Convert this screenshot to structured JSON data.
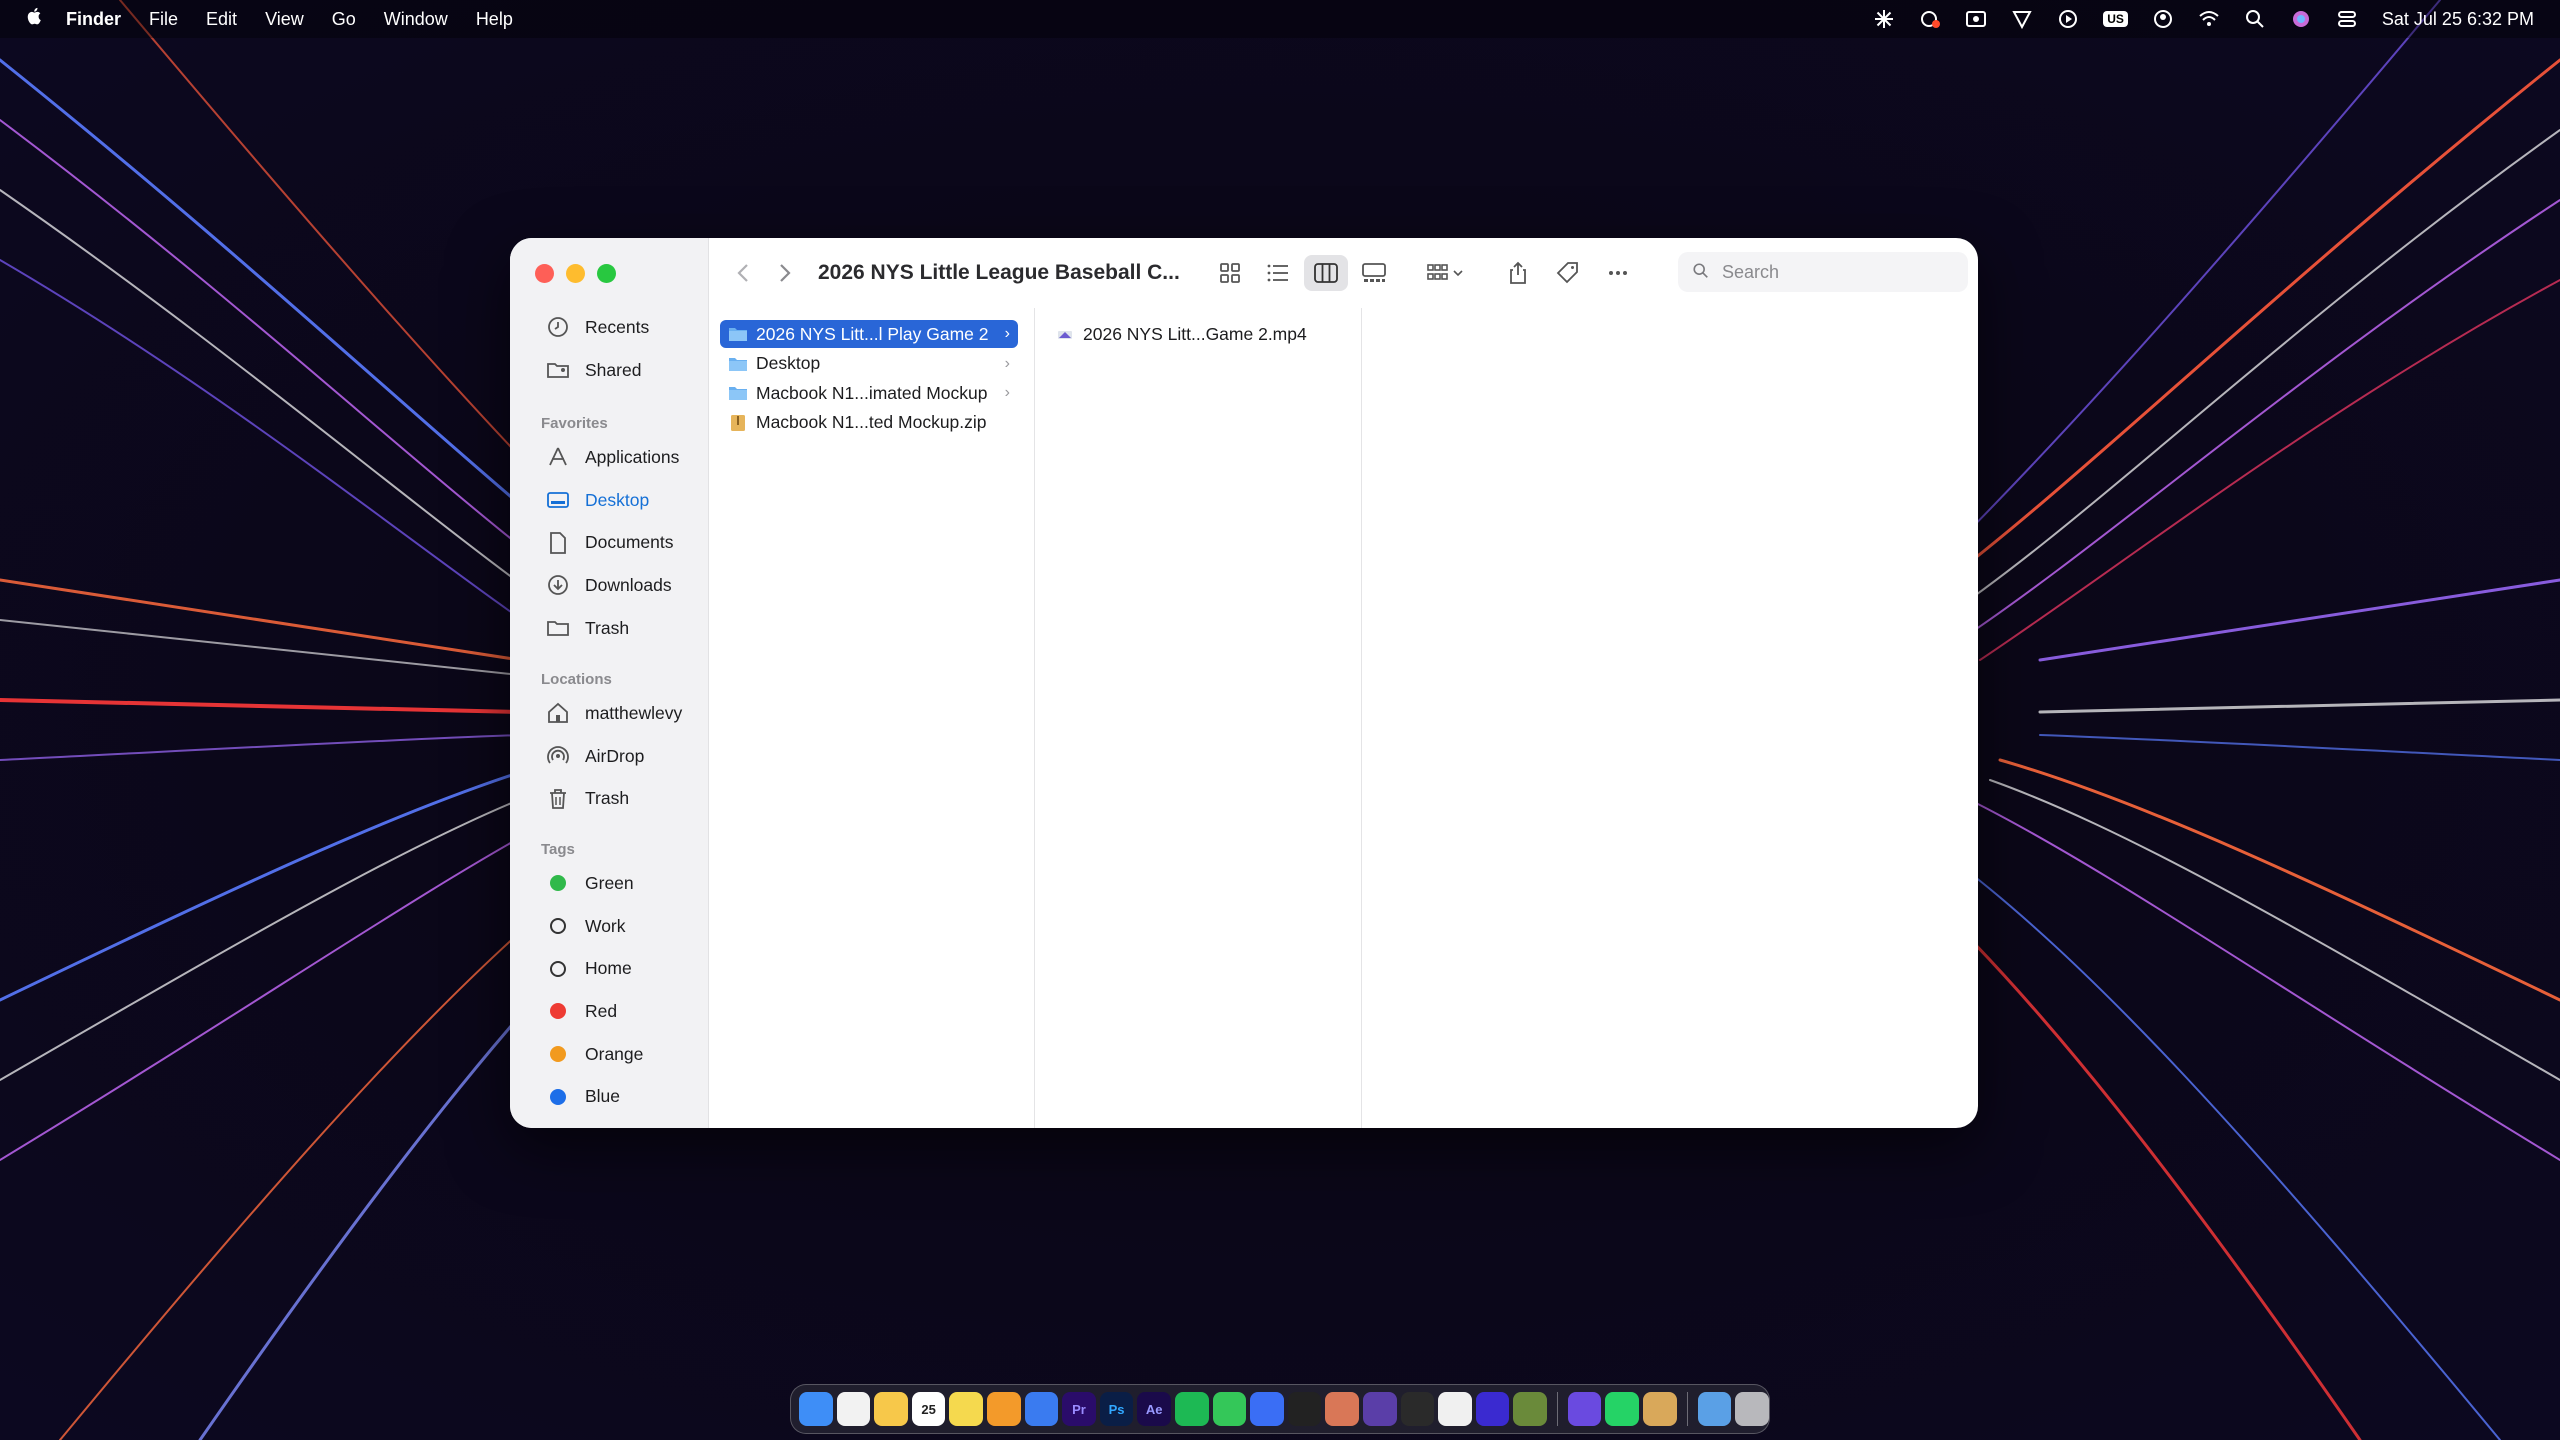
{
  "menubar": {
    "app_name": "Finder",
    "menus": [
      "File",
      "Edit",
      "View",
      "Go",
      "Window",
      "Help"
    ],
    "keyboard_badge": "US",
    "clock": "Sat Jul 25  6:32 PM"
  },
  "window": {
    "title": "2026 NYS Little League Baseball C...",
    "search_placeholder": "Search"
  },
  "sidebar": {
    "top_items": [
      {
        "label": "Recents",
        "icon": "clock-icon"
      },
      {
        "label": "Shared",
        "icon": "shared-folder-icon"
      }
    ],
    "favorites_heading": "Favorites",
    "favorites": [
      {
        "label": "Applications",
        "icon": "applications-icon"
      },
      {
        "label": "Desktop",
        "icon": "desktop-icon"
      },
      {
        "label": "Documents",
        "icon": "document-icon"
      },
      {
        "label": "Downloads",
        "icon": "download-icon"
      },
      {
        "label": "Trash",
        "icon": "folder-icon"
      }
    ],
    "locations_heading": "Locations",
    "locations": [
      {
        "label": "matthewlevy",
        "icon": "home-icon"
      },
      {
        "label": "AirDrop",
        "icon": "airdrop-icon"
      },
      {
        "label": "Trash",
        "icon": "trash-icon"
      }
    ],
    "tags_heading": "Tags",
    "tags": [
      {
        "label": "Green",
        "color": "#30b94a"
      },
      {
        "label": "Work",
        "color": "hollow"
      },
      {
        "label": "Home",
        "color": "hollow"
      },
      {
        "label": "Red",
        "color": "#ee3b33"
      },
      {
        "label": "Orange",
        "color": "#f29a1e"
      },
      {
        "label": "Blue",
        "color": "#1d6ee8"
      }
    ]
  },
  "columns": {
    "col1": [
      {
        "name": "2026 NYS Litt...l Play Game 2",
        "kind": "folder",
        "selected": true
      },
      {
        "name": "Desktop",
        "kind": "folder"
      },
      {
        "name": "Macbook N1...imated Mockup",
        "kind": "folder"
      },
      {
        "name": "Macbook N1...ted Mockup.zip",
        "kind": "zip"
      }
    ],
    "col2": [
      {
        "name": "2026 NYS Litt...Game 2.mp4",
        "kind": "video"
      }
    ]
  },
  "dock": {
    "apps": [
      "Finder",
      "Chrome",
      "Photos",
      "Calendar",
      "Notes",
      "Pages",
      "TestFlight",
      "Premiere Pro",
      "Photoshop",
      "After Effects",
      "Spotify",
      "Messages",
      "Messenger",
      "Cursor",
      "Claude",
      "Notchmeister",
      "Final Cut",
      "ChatGPT",
      "Audio",
      "Reeder",
      "Proton VPN",
      "WhatsApp",
      "Preview",
      "Downloads",
      "Trash"
    ],
    "calendar_day": "25",
    "labels": {
      "pr": "Pr",
      "ps": "Ps",
      "ae": "Ae"
    }
  },
  "colors": {
    "accent": "#2966d7",
    "sidebar_selected": "#1570d6"
  }
}
